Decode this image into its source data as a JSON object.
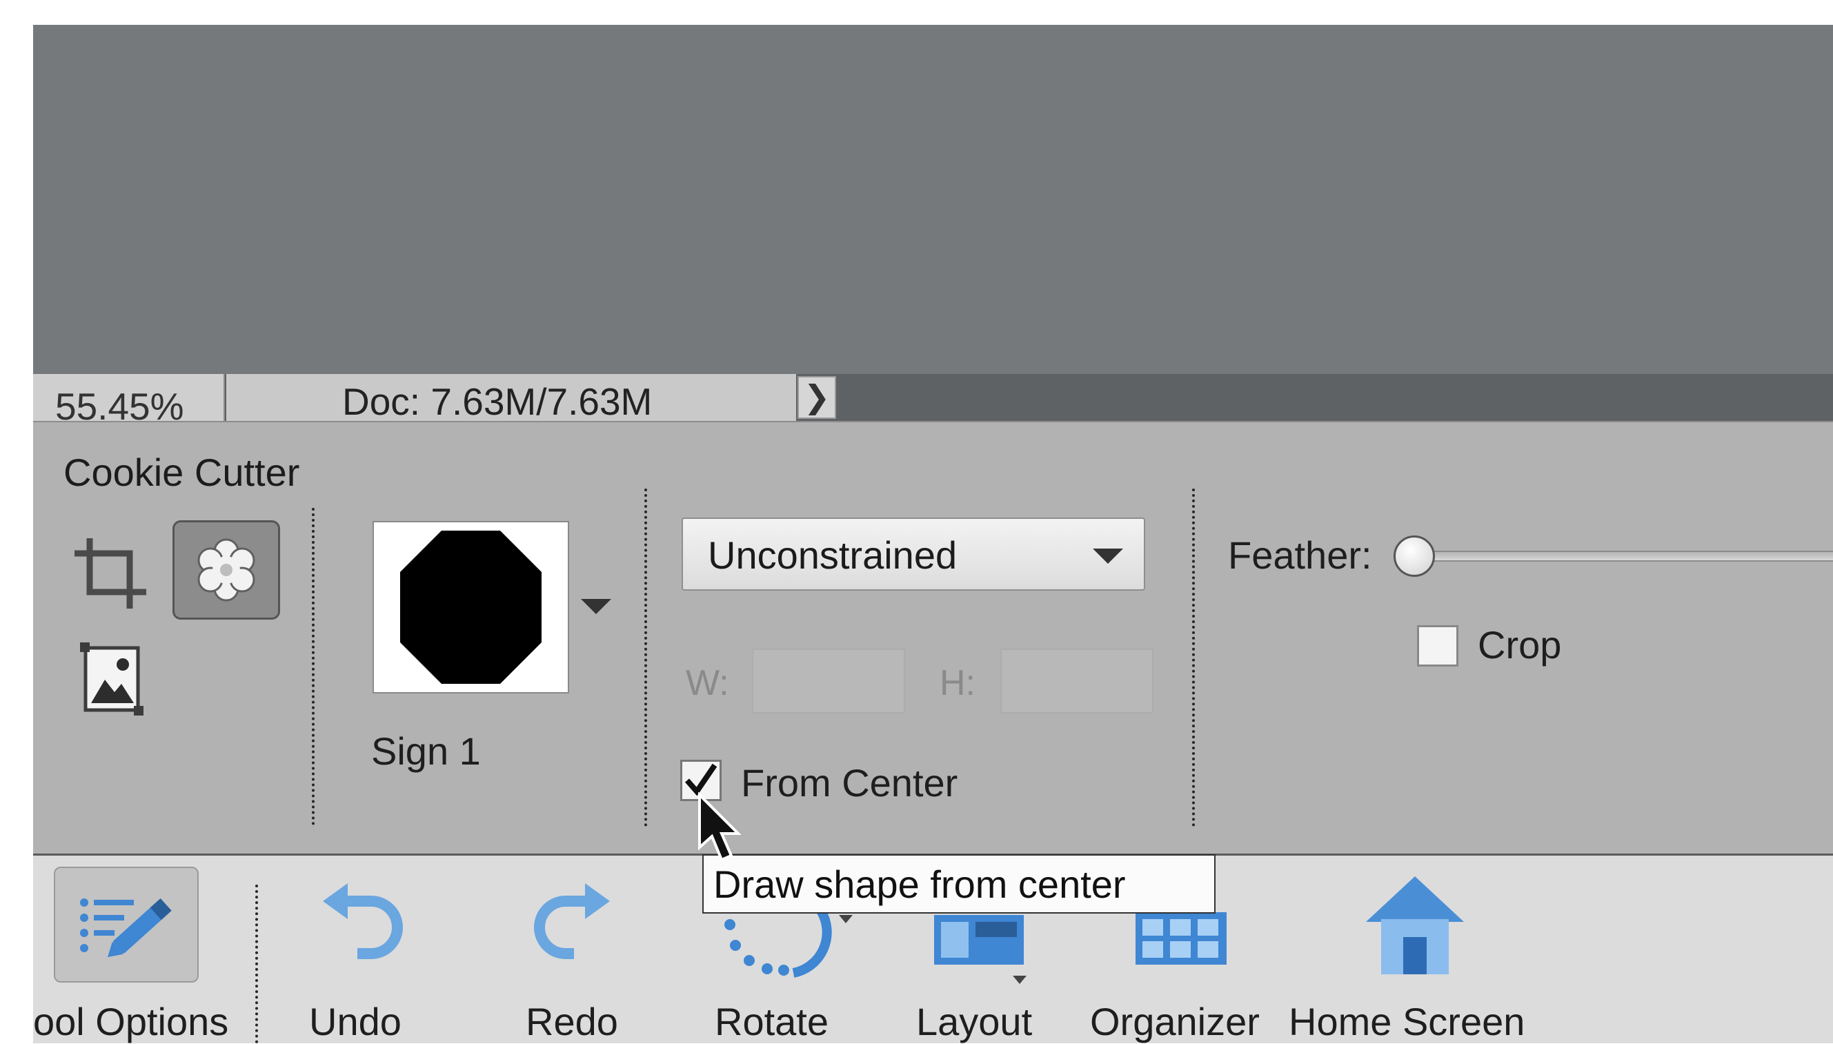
{
  "status_bar": {
    "zoom": "55.45%",
    "doc_info": "Doc: 7.63M/7.63M",
    "expand_arrow": "❯"
  },
  "tool_options": {
    "tool_name": "Cookie Cutter",
    "tools": [
      {
        "icon": "crop-icon",
        "selected": false
      },
      {
        "icon": "cookie-cutter-icon",
        "selected": true
      },
      {
        "icon": "straighten-icon",
        "selected": false
      }
    ],
    "shape": {
      "name": "Sign 1",
      "icon": "octagon-shape-icon"
    },
    "aspect": {
      "selected": "Unconstrained",
      "width_label": "W:",
      "height_label": "H:",
      "width_value": "",
      "height_value": ""
    },
    "from_center": {
      "label": "From Center",
      "checked": true
    },
    "feather": {
      "label": "Feather:",
      "value": 0
    },
    "crop": {
      "label": "Crop",
      "checked": false
    }
  },
  "tooltip": {
    "text": "Draw shape from center"
  },
  "taskbar": {
    "items": [
      {
        "label": "ool Options",
        "icon": "tool-options-icon"
      },
      {
        "label": "Undo",
        "icon": "undo-icon"
      },
      {
        "label": "Redo",
        "icon": "redo-icon"
      },
      {
        "label": "Rotate",
        "icon": "rotate-icon"
      },
      {
        "label": "Layout",
        "icon": "layout-icon"
      },
      {
        "label": "Organizer",
        "icon": "organizer-icon"
      },
      {
        "label": "Home Screen",
        "icon": "home-icon"
      }
    ]
  },
  "colors": {
    "canvas": "#76797c",
    "panel": "#b2b2b2",
    "taskbar": "#dcdcdc",
    "icon_blue": "#3f86d3"
  }
}
